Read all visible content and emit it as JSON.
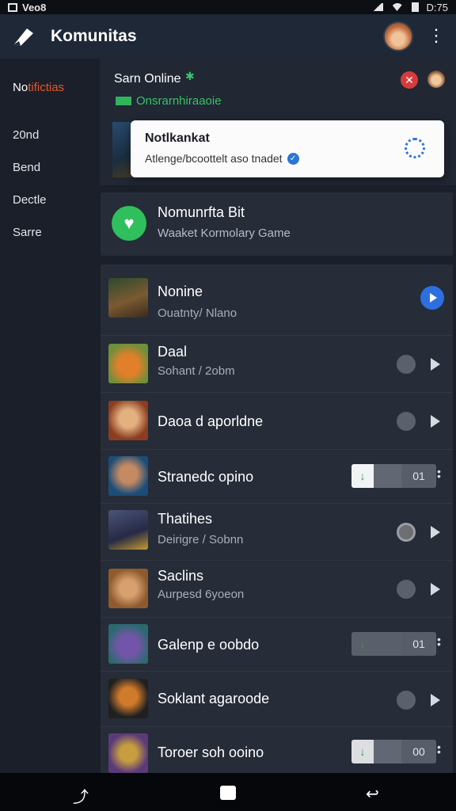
{
  "status_bar": {
    "left_text": "Veo8",
    "time": "D:75"
  },
  "app_bar": {
    "title": "Komunitas",
    "logo_icon": "pencil-icon",
    "more_icon": "more-vert-icon"
  },
  "sidebar": {
    "items": [
      {
        "label_plain": "No",
        "label_accent": "tifictias"
      },
      {
        "label": "20nd"
      },
      {
        "label": "Bend"
      },
      {
        "label": "Dectle"
      },
      {
        "label": "Sarre"
      }
    ]
  },
  "online_card": {
    "name": "Sarn Online",
    "status": "Onsrarnhiraaoie"
  },
  "toast": {
    "title": "Notlkankat",
    "message": "Atlenge/bcoottelt aso tnadet"
  },
  "bot_card": {
    "name": "Nomunrfta Bit",
    "subtitle": "Waaket Kormolary Game"
  },
  "rows": [
    {
      "name": "Nonine",
      "sub": "Ouatnty/ Nlano",
      "control": "blue-play"
    },
    {
      "name": "Daal",
      "sub": "Sohant / 2obm",
      "control": "circle-play"
    },
    {
      "name": "Daoa d aporldne",
      "sub": "",
      "control": "circle-play"
    },
    {
      "name": "Stranedc opino",
      "sub": "",
      "control": "toggle",
      "toggle_mark": "↓",
      "counter": "01"
    },
    {
      "name": "Thatihes",
      "sub": "Deirigre / Sobnn",
      "control": "gold-play"
    },
    {
      "name": "Saclins",
      "sub": "Aurpesd 6yoeon",
      "control": "circle-play"
    },
    {
      "name": "Galenp e oobdo",
      "sub": "",
      "control": "toggle",
      "toggle_mark": "↓",
      "counter": "01"
    },
    {
      "name": "Soklant agaroode",
      "sub": "",
      "control": "circle-play"
    },
    {
      "name": "Toroer soh ooino",
      "sub": "",
      "control": "toggle",
      "toggle_mark": "↓",
      "counter": "00"
    }
  ],
  "colors": {
    "accent_green": "#2fbf5d",
    "accent_blue": "#2d6fe0",
    "accent_red": "#d63b3b",
    "accent_orange": "#e4572e"
  }
}
